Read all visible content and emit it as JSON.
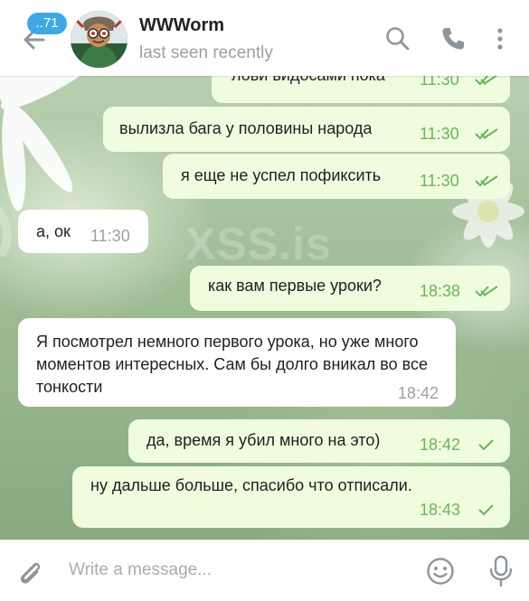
{
  "header": {
    "unread_badge": "..71",
    "chat_title": "WWWorm",
    "status": "last seen recently"
  },
  "watermark": "XSS.is",
  "messages": [
    {
      "text": "лови видосами пока",
      "time": "11:30",
      "direction": "out",
      "read": true
    },
    {
      "text": "вылизла бага у половины народа",
      "time": "11:30",
      "direction": "out",
      "read": true
    },
    {
      "text": "я еще не успел пофиксить",
      "time": "11:30",
      "direction": "out",
      "read": true
    },
    {
      "text": "а, ок",
      "time": "11:30",
      "direction": "in"
    },
    {
      "text": "как вам первые уроки?",
      "time": "18:38",
      "direction": "out",
      "read": true
    },
    {
      "text": "Я посмотрел немного первого урока, но уже много моментов интересных. Сам бы долго вникал во все тонкости",
      "time": "18:42",
      "direction": "in"
    },
    {
      "text": "да, время я убил много на это)",
      "time": "18:42",
      "direction": "out",
      "read": false
    },
    {
      "text": "ну дальше больше, спасибо что отписали.",
      "time": "18:43",
      "direction": "out",
      "read": false
    }
  ],
  "composer": {
    "placeholder": "Write a message..."
  },
  "colors": {
    "accent": "#40a7e3",
    "outgoing_bubble": "#effdde",
    "incoming_bubble": "#ffffff",
    "outgoing_time": "#6bb35d"
  },
  "icons": [
    "back-arrow-icon",
    "search-icon",
    "phone-icon",
    "more-vertical-icon",
    "attach-icon",
    "emoji-icon",
    "microphone-icon",
    "double-check-icon",
    "check-icon"
  ]
}
